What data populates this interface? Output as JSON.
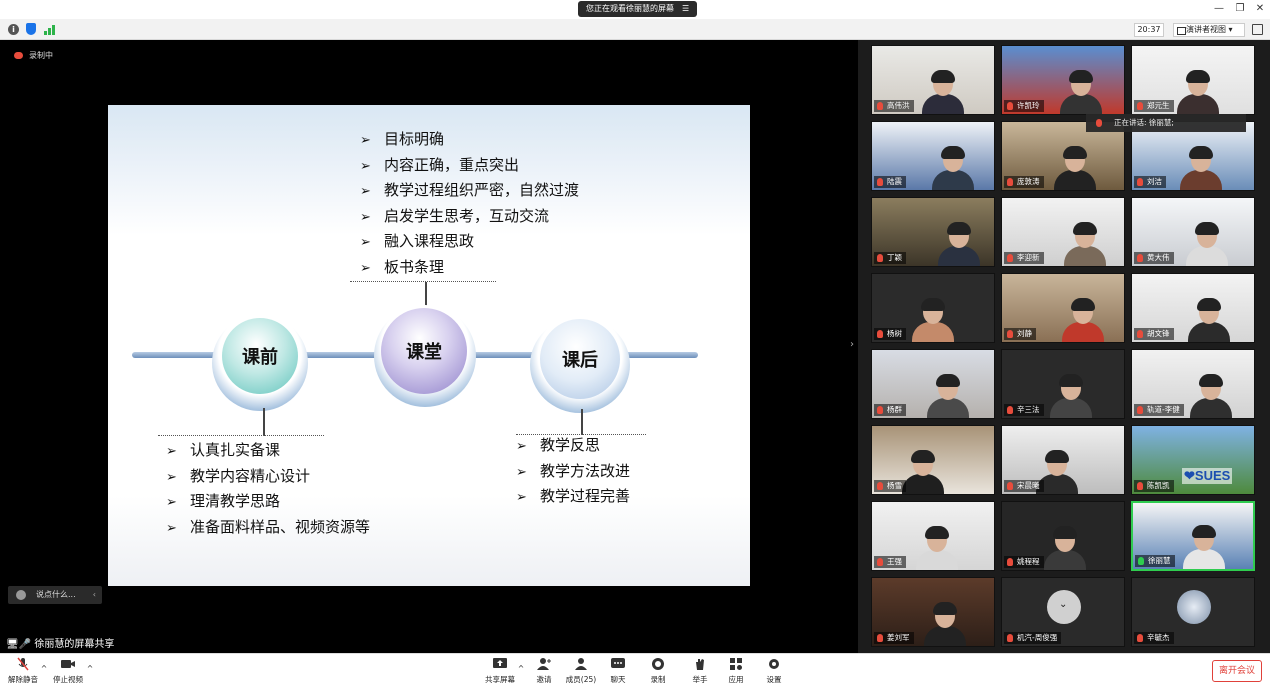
{
  "window": {
    "title": "您正在观看徐丽慧的屏幕",
    "title_menu_icon": "menu-icon"
  },
  "toolbar": {
    "time": "20:37",
    "view_button": "演讲者视图"
  },
  "recording": {
    "label": "录制中"
  },
  "slide": {
    "top_bullets": [
      "目标明确",
      "内容正确，重点突出",
      "教学过程组织严密，自然过渡",
      "启发学生思考，互动交流",
      "融入课程思政",
      "板书条理"
    ],
    "nodes": [
      "课前",
      "课堂",
      "课后"
    ],
    "left_bullets": [
      "认真扎实备课",
      "教学内容精心设计",
      "理清教学思路",
      "准备面料样品、视频资源等"
    ],
    "right_bullets": [
      "教学反思",
      "教学方法改进",
      "教学过程完善"
    ]
  },
  "chat": {
    "placeholder": "说点什么..."
  },
  "sharer": {
    "label": "徐丽慧的屏幕共享"
  },
  "speaking": {
    "label": "正在讲话: 徐丽慧;"
  },
  "participants": [
    {
      "name": "高伟洪"
    },
    {
      "name": "许凯玲"
    },
    {
      "name": "郑元生"
    },
    {
      "name": "陆震"
    },
    {
      "name": "庞敦涛"
    },
    {
      "name": "刘洁"
    },
    {
      "name": "丁颖"
    },
    {
      "name": "李迎新"
    },
    {
      "name": "黄大伟"
    },
    {
      "name": "杨树"
    },
    {
      "name": "刘静"
    },
    {
      "name": "胡文锋"
    },
    {
      "name": "杨群"
    },
    {
      "name": "辛三法"
    },
    {
      "name": "轨道-李健"
    },
    {
      "name": "杨雪"
    },
    {
      "name": "宋晨曦"
    },
    {
      "name": "陈凯凯"
    },
    {
      "name": "王强"
    },
    {
      "name": "姚程程"
    },
    {
      "name": "徐丽慧"
    },
    {
      "name": "姜刘军"
    },
    {
      "name": "机汽-周俊强"
    },
    {
      "name": "辛毓杰"
    }
  ],
  "bottom": {
    "unmute": "解除静音",
    "stop_video": "停止视频",
    "share_screen": "共享屏幕",
    "invite": "邀请",
    "members": "成员(25)",
    "chat": "聊天",
    "record": "录制",
    "raise_hand": "举手",
    "apps": "应用",
    "settings": "设置",
    "leave": "离开会议"
  },
  "colors": {
    "accent": "#2fcc4f",
    "leave": "#e0413a",
    "node_gradient": "#c8d8f0"
  }
}
